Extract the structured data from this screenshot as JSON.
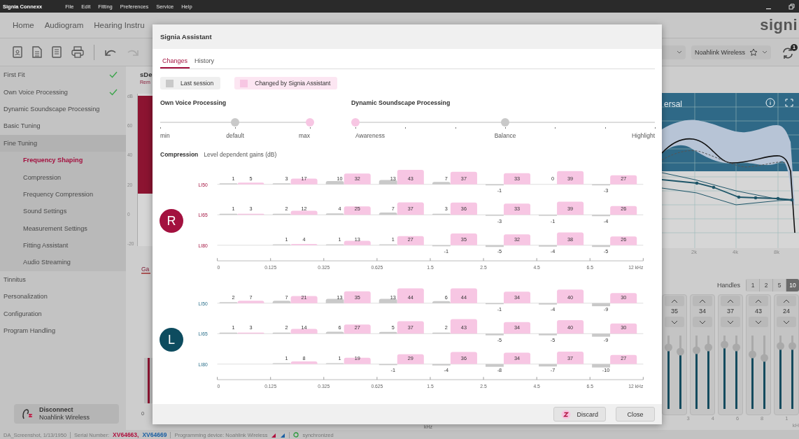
{
  "menu_bar": {
    "app_name": "Signia Connexx",
    "items": [
      "File",
      "Edit",
      "Fitting",
      "Preferences",
      "Service",
      "Help"
    ]
  },
  "nav": {
    "tabs": [
      {
        "label": "Home",
        "selected": false
      },
      {
        "label": "Audiogram",
        "selected": false
      },
      {
        "label": "Hearing Instru",
        "selected": false
      }
    ],
    "logo": "signi"
  },
  "toolbar": {
    "device": "Noahlink Wireless",
    "sync_badge": "1"
  },
  "sidebar": {
    "items": [
      {
        "label": "First Fit",
        "done": true,
        "selected": false
      },
      {
        "label": "Own Voice Processing",
        "done": true,
        "selected": false
      },
      {
        "label": "Dynamic Soundscape Processing",
        "done": false,
        "selected": false
      },
      {
        "label": "Basic Tuning",
        "done": false,
        "selected": false
      },
      {
        "label": "Fine Tuning",
        "done": false,
        "selected": false,
        "expanded": true,
        "children": [
          {
            "label": "Frequency Shaping",
            "selected": true
          },
          {
            "label": "Compression",
            "selected": false
          },
          {
            "label": "Frequency Compression",
            "selected": false
          },
          {
            "label": "Sound Settings",
            "selected": false
          },
          {
            "label": "Measurement Settings",
            "selected": false
          },
          {
            "label": "Fitting Assistant",
            "selected": false
          },
          {
            "label": "Audio Streaming",
            "selected": false
          }
        ]
      },
      {
        "label": "Tinnitus",
        "done": false,
        "selected": false
      },
      {
        "label": "Personalization",
        "done": false,
        "selected": false
      },
      {
        "label": "Configuration",
        "done": false,
        "selected": false
      },
      {
        "label": "Program Handling",
        "done": false,
        "selected": false
      }
    ],
    "disconnect": {
      "title": "Disconnect",
      "subtitle": "Noahlink Wireless"
    }
  },
  "background_left": {
    "title": "sDe",
    "subtitle": "Rem",
    "unit": "dB",
    "yticks": [
      "60",
      "40",
      "20",
      "0",
      "-20"
    ],
    "tab": "Ga",
    "bottom_tick": "0"
  },
  "background_center": {
    "axis_unit": "kHz"
  },
  "graph": {
    "title": "ersal",
    "xlabels": [
      "2k",
      "4k",
      "8k"
    ]
  },
  "handles": {
    "label": "Handles",
    "options": [
      {
        "label": "1",
        "selected": false
      },
      {
        "label": "2",
        "selected": false
      },
      {
        "label": "5",
        "selected": false
      },
      {
        "label": "10",
        "selected": true
      }
    ]
  },
  "eq_columns": [
    {
      "value": "35",
      "sliders": [
        {
          "level": 0.84
        },
        {
          "level": 0.78
        }
      ]
    },
    {
      "value": "34",
      "sliders": [
        {
          "level": 0.8
        },
        {
          "level": 0.84
        }
      ]
    },
    {
      "value": "37",
      "sliders": [
        {
          "level": 0.88
        },
        {
          "level": 0.84
        }
      ]
    },
    {
      "value": "43",
      "sliders": [
        {
          "level": 0.74
        },
        {
          "level": 0.7
        }
      ]
    },
    {
      "value": "24",
      "sliders": [
        {
          "level": 0.86
        },
        {
          "level": 0.86
        }
      ]
    }
  ],
  "eq_axis": [
    "3",
    "4",
    "6",
    "8",
    "1"
  ],
  "eq_unit": "kH",
  "dialog": {
    "title": "Signia Assistant",
    "tabs": [
      {
        "label": "Changes",
        "selected": true
      },
      {
        "label": "History",
        "selected": false
      }
    ],
    "legend": [
      {
        "kind": "last",
        "label": "Last session"
      },
      {
        "kind": "changed",
        "label": "Changed by Signia Assistant"
      }
    ],
    "sliders": [
      {
        "title": "Own Voice Processing",
        "stops": [
          {
            "kind": "labeled",
            "label": "min"
          },
          {
            "kind": "labeled",
            "label": "default"
          },
          {
            "kind": "labeled",
            "label": "max"
          }
        ],
        "thumbs": [
          {
            "kind": "last",
            "level": 0.5
          },
          {
            "kind": "changed",
            "level": 1
          }
        ]
      },
      {
        "title": "Dynamic Soundscape Processing",
        "stops": [
          {
            "kind": "labeled",
            "label": "Awareness"
          },
          {
            "kind": "tick"
          },
          {
            "kind": "tick"
          },
          {
            "kind": "labeled",
            "label": "Balance"
          },
          {
            "kind": "tick"
          },
          {
            "kind": "tick"
          },
          {
            "kind": "labeled",
            "label": "Highlight"
          }
        ],
        "thumbs": [
          {
            "kind": "last",
            "level": 0.5
          },
          {
            "kind": "changed",
            "level": 0
          }
        ]
      }
    ],
    "compression": {
      "title": "Compression",
      "subtitle": "Level dependent gains (dB)",
      "sides": [
        {
          "label": "R",
          "kind": "right",
          "axis": [
            "0",
            "0.125",
            "0.325",
            "0.625",
            "1.5",
            "2.5",
            "4.5",
            "6.5",
            "12 kHz"
          ],
          "rows": [
            {
              "label": "LI50",
              "bands": [
                {
                  "kind": "gain",
                  "last": "1",
                  "changed": "5"
                },
                {
                  "kind": "gain",
                  "last": "3",
                  "changed": "17"
                },
                {
                  "kind": "gain",
                  "last": "10",
                  "changed": "32"
                },
                {
                  "kind": "gain",
                  "last": "13",
                  "changed": "43"
                },
                {
                  "kind": "gain",
                  "last": "7",
                  "changed": "37"
                },
                {
                  "kind": "gain",
                  "last": "-1",
                  "changed": "33"
                },
                {
                  "kind": "gain",
                  "last": "0",
                  "changed": "39"
                },
                {
                  "kind": "gain",
                  "last": "-3",
                  "changed": "27"
                }
              ]
            },
            {
              "label": "LI65",
              "bands": [
                {
                  "kind": "gain",
                  "last": "1",
                  "changed": "3"
                },
                {
                  "kind": "gain",
                  "last": "2",
                  "changed": "12"
                },
                {
                  "kind": "gain",
                  "last": "4",
                  "changed": "25"
                },
                {
                  "kind": "gain",
                  "last": "7",
                  "changed": "37"
                },
                {
                  "kind": "gain",
                  "last": "3",
                  "changed": "36"
                },
                {
                  "kind": "gain",
                  "last": "-3",
                  "changed": "33"
                },
                {
                  "kind": "gain",
                  "last": "-1",
                  "changed": "39"
                },
                {
                  "kind": "gain",
                  "last": "-4",
                  "changed": "26"
                }
              ]
            },
            {
              "label": "LI80",
              "bands": [
                {
                  "kind": "empty"
                },
                {
                  "kind": "gain",
                  "last": "1",
                  "changed": "4"
                },
                {
                  "kind": "gain",
                  "last": "1",
                  "changed": "13"
                },
                {
                  "kind": "gain",
                  "last": "1",
                  "changed": "27"
                },
                {
                  "kind": "gain",
                  "last": "-1",
                  "changed": "35"
                },
                {
                  "kind": "gain",
                  "last": "-5",
                  "changed": "32"
                },
                {
                  "kind": "gain",
                  "last": "-4",
                  "changed": "38"
                },
                {
                  "kind": "gain",
                  "last": "-5",
                  "changed": "26"
                }
              ]
            }
          ]
        },
        {
          "label": "L",
          "kind": "left",
          "axis": [
            "0",
            "0.125",
            "0.325",
            "0.625",
            "1.5",
            "2.5",
            "4.5",
            "6.5",
            "12 kHz"
          ],
          "rows": [
            {
              "label": "LI50",
              "bands": [
                {
                  "kind": "gain",
                  "last": "2",
                  "changed": "7"
                },
                {
                  "kind": "gain",
                  "last": "7",
                  "changed": "21"
                },
                {
                  "kind": "gain",
                  "last": "13",
                  "changed": "35"
                },
                {
                  "kind": "gain",
                  "last": "13",
                  "changed": "44"
                },
                {
                  "kind": "gain",
                  "last": "6",
                  "changed": "44"
                },
                {
                  "kind": "gain",
                  "last": "-1",
                  "changed": "34"
                },
                {
                  "kind": "gain",
                  "last": "-4",
                  "changed": "40"
                },
                {
                  "kind": "gain",
                  "last": "-9",
                  "changed": "30"
                }
              ]
            },
            {
              "label": "LI65",
              "bands": [
                {
                  "kind": "gain",
                  "last": "1",
                  "changed": "3"
                },
                {
                  "kind": "gain",
                  "last": "2",
                  "changed": "14"
                },
                {
                  "kind": "gain",
                  "last": "6",
                  "changed": "27"
                },
                {
                  "kind": "gain",
                  "last": "5",
                  "changed": "37"
                },
                {
                  "kind": "gain",
                  "last": "2",
                  "changed": "43"
                },
                {
                  "kind": "gain",
                  "last": "-5",
                  "changed": "34"
                },
                {
                  "kind": "gain",
                  "last": "-5",
                  "changed": "40"
                },
                {
                  "kind": "gain",
                  "last": "-9",
                  "changed": "30"
                }
              ]
            },
            {
              "label": "LI80",
              "bands": [
                {
                  "kind": "empty"
                },
                {
                  "kind": "gain",
                  "last": "1",
                  "changed": "8"
                },
                {
                  "kind": "gain",
                  "last": "1",
                  "changed": "19"
                },
                {
                  "kind": "gain",
                  "last": "-1",
                  "changed": "29"
                },
                {
                  "kind": "gain",
                  "last": "-4",
                  "changed": "36"
                },
                {
                  "kind": "gain",
                  "last": "-8",
                  "changed": "34"
                },
                {
                  "kind": "gain",
                  "last": "-7",
                  "changed": "37"
                },
                {
                  "kind": "gain",
                  "last": "-10",
                  "changed": "27"
                }
              ]
            }
          ]
        }
      ]
    },
    "buttons": [
      {
        "kind": "discard",
        "label": "Discard"
      },
      {
        "kind": "close",
        "label": "Close"
      }
    ]
  },
  "status_bar": {
    "file": "DA_Screenshot, 1/13/1950",
    "serial_label": "Serial Number:",
    "serials": [
      {
        "text": "XV64663,",
        "color": "#b0103e"
      },
      {
        "text": "XV64669",
        "color": "#1b5fa3"
      }
    ],
    "device": "Programming device: Noahlink Wireless",
    "sync": "synchronized"
  }
}
